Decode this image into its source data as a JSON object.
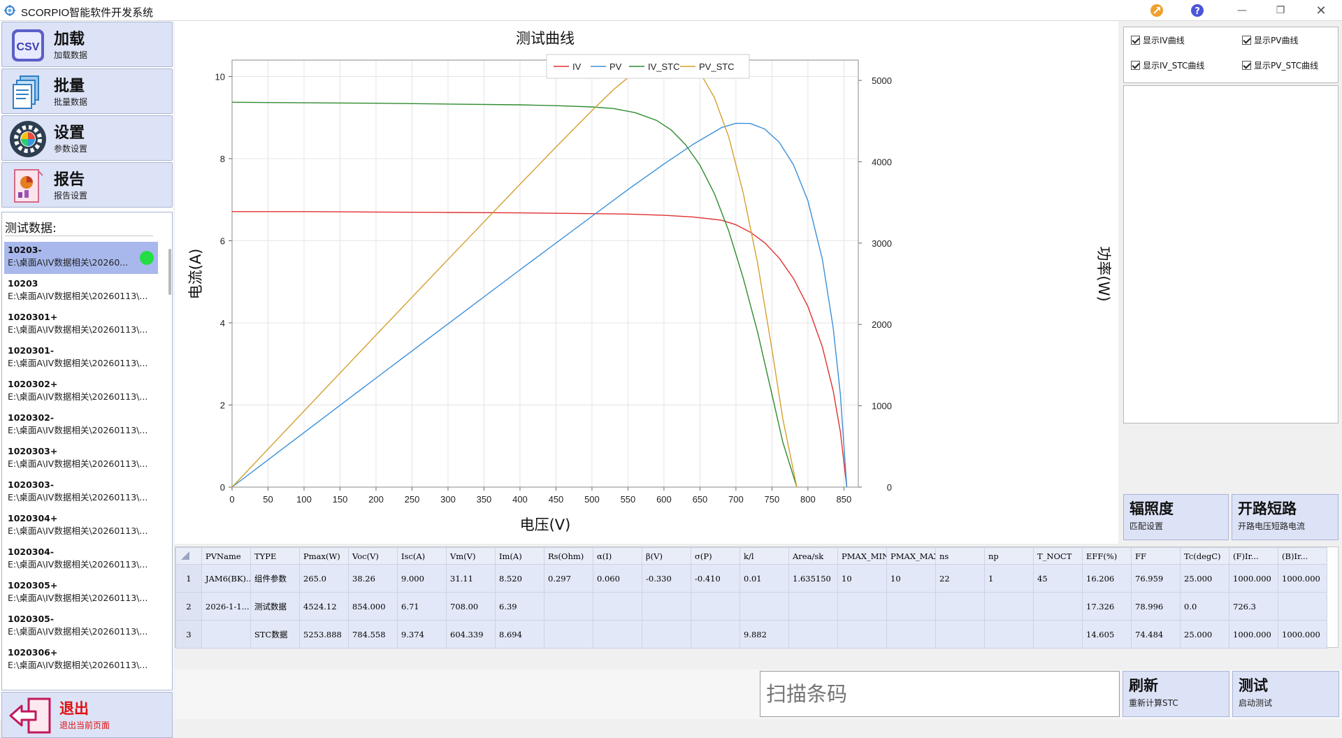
{
  "window": {
    "title": "SCORPIO智能软件开发系统"
  },
  "sidebar": {
    "nav": [
      {
        "label": "加载",
        "sub": "加载数据",
        "icon": "csv-file-icon"
      },
      {
        "label": "批量",
        "sub": "批量数据",
        "icon": "batch-files-icon"
      },
      {
        "label": "设置",
        "sub": "参数设置",
        "icon": "gear-icon"
      },
      {
        "label": "报告",
        "sub": "报告设置",
        "icon": "report-icon"
      }
    ],
    "list_title": "测试数据:",
    "items": [
      {
        "name": "10203-",
        "path": "E:\\桌面A\\IV数据相关\\20260..."
      },
      {
        "name": "10203",
        "path": "E:\\桌面A\\IV数据相关\\20260113\\..."
      },
      {
        "name": "1020301+",
        "path": "E:\\桌面A\\IV数据相关\\20260113\\..."
      },
      {
        "name": "1020301-",
        "path": "E:\\桌面A\\IV数据相关\\20260113\\..."
      },
      {
        "name": "1020302+",
        "path": "E:\\桌面A\\IV数据相关\\20260113\\..."
      },
      {
        "name": "1020302-",
        "path": "E:\\桌面A\\IV数据相关\\20260113\\..."
      },
      {
        "name": "1020303+",
        "path": "E:\\桌面A\\IV数据相关\\20260113\\..."
      },
      {
        "name": "1020303-",
        "path": "E:\\桌面A\\IV数据相关\\20260113\\..."
      },
      {
        "name": "1020304+",
        "path": "E:\\桌面A\\IV数据相关\\20260113\\..."
      },
      {
        "name": "1020304-",
        "path": "E:\\桌面A\\IV数据相关\\20260113\\..."
      },
      {
        "name": "1020305+",
        "path": "E:\\桌面A\\IV数据相关\\20260113\\..."
      },
      {
        "name": "1020305-",
        "path": "E:\\桌面A\\IV数据相关\\20260113\\..."
      },
      {
        "name": "1020306+",
        "path": "E:\\桌面A\\IV数据相关\\20260113\\..."
      }
    ],
    "exit": {
      "label": "退出",
      "sub": "退出当前页面"
    }
  },
  "right_panel": {
    "checkboxes": [
      "显示IV曲线",
      "显示PV曲线",
      "显示IV_STC曲线",
      "显示PV_STC曲线"
    ],
    "buttons": [
      {
        "label": "辐照度",
        "sub": "匹配设置"
      },
      {
        "label": "开路短路",
        "sub": "开路电压短路电流"
      }
    ]
  },
  "bottom": {
    "scan_placeholder": "扫描条码",
    "refresh": {
      "label": "刷新",
      "sub": "重新计算STC"
    },
    "test": {
      "label": "测试",
      "sub": "启动测试"
    }
  },
  "table": {
    "columns": [
      "PVName",
      "TYPE",
      "Pmax(W)",
      "Voc(V)",
      "Isc(A)",
      "Vm(V)",
      "Im(A)",
      "Rs(Ohm)",
      "α(I)",
      "β(V)",
      "σ(P)",
      "k/l",
      "Area/sk",
      "PMAX_MIN",
      "PMAX_MAX",
      "ns",
      "np",
      "T_NOCT",
      "EFF(%)",
      "FF",
      "Tc(degC)",
      "(F)Ir...",
      "(B)Ir..."
    ],
    "rows": [
      [
        "1",
        "JAM6(BK)...",
        "组件参数",
        "265.0",
        "38.26",
        "9.000",
        "31.11",
        "8.520",
        "0.297",
        "0.060",
        "-0.330",
        "-0.410",
        "0.01",
        "1.635150",
        "10",
        "10",
        "22",
        "1",
        "45",
        "16.206",
        "76.959",
        "25.000",
        "1000.000",
        "1000.000"
      ],
      [
        "2",
        "2026-1-1...",
        "测试数据",
        "4524.12",
        "854.000",
        "6.71",
        "708.00",
        "6.39",
        "",
        "",
        "",
        "",
        "",
        "",
        "",
        "",
        "",
        "",
        "",
        "17.326",
        "78.996",
        "0.0",
        "726.3",
        ""
      ],
      [
        "3",
        "",
        "STC数据",
        "5253.888",
        "784.558",
        "9.374",
        "604.339",
        "8.694",
        "",
        "",
        "",
        "",
        "9.882",
        "",
        "",
        "",
        "",
        "",
        "",
        "14.605",
        "74.484",
        "25.000",
        "1000.000",
        "1000.000"
      ]
    ]
  },
  "chart_data": {
    "type": "line",
    "title": "测试曲线",
    "xlabel": "电压(V)",
    "ylabel": "电流(A)",
    "y2label": "功率(W)",
    "xlim": [
      0,
      870
    ],
    "ylim": [
      0,
      10.4
    ],
    "y2lim": [
      0,
      5250
    ],
    "xticks": [
      0,
      50,
      100,
      150,
      200,
      250,
      300,
      350,
      400,
      450,
      500,
      550,
      600,
      650,
      700,
      750,
      800,
      850
    ],
    "yticks": [
      0,
      2,
      4,
      6,
      8,
      10
    ],
    "y2ticks": [
      0,
      1000,
      2000,
      3000,
      4000,
      5000
    ],
    "grid": true,
    "legend_position": "top-center",
    "series": [
      {
        "name": "IV",
        "axis": "left",
        "color": "#e03030",
        "x": [
          0,
          100,
          200,
          300,
          400,
          500,
          550,
          600,
          640,
          680,
          700,
          720,
          740,
          760,
          780,
          800,
          820,
          835,
          845,
          854
        ],
        "y": [
          6.71,
          6.71,
          6.7,
          6.69,
          6.68,
          6.66,
          6.65,
          6.62,
          6.58,
          6.5,
          6.39,
          6.21,
          5.95,
          5.58,
          5.08,
          4.4,
          3.42,
          2.35,
          1.35,
          0.0
        ]
      },
      {
        "name": "PV",
        "axis": "right",
        "color": "#3a8fd8",
        "x": [
          0,
          100,
          200,
          300,
          400,
          500,
          550,
          600,
          640,
          680,
          700,
          720,
          740,
          760,
          780,
          800,
          820,
          835,
          845,
          854
        ],
        "y": [
          0,
          671,
          1340,
          2007,
          2672,
          3330,
          3658,
          3972,
          4211,
          4420,
          4473,
          4471,
          4403,
          4241,
          3962,
          3520,
          2804,
          1962,
          1141,
          0
        ]
      },
      {
        "name": "IV_STC",
        "axis": "left",
        "color": "#2e8b2e",
        "x": [
          0,
          100,
          200,
          300,
          400,
          450,
          500,
          530,
          560,
          590,
          610,
          630,
          650,
          670,
          690,
          710,
          730,
          750,
          765,
          784.558
        ],
        "y": [
          9.374,
          9.36,
          9.35,
          9.33,
          9.31,
          9.29,
          9.26,
          9.22,
          9.12,
          8.93,
          8.7,
          8.34,
          7.84,
          7.15,
          6.24,
          5.1,
          3.78,
          2.26,
          1.1,
          0.0
        ]
      },
      {
        "name": "PV_STC",
        "axis": "right",
        "color": "#d4a030",
        "x": [
          0,
          100,
          200,
          300,
          400,
          450,
          500,
          530,
          560,
          590,
          610,
          630,
          650,
          670,
          690,
          710,
          730,
          750,
          765,
          784.558
        ],
        "y": [
          0,
          936,
          1870,
          2799,
          3724,
          4180,
          4630,
          4887,
          5107,
          5269,
          5307,
          5254,
          5096,
          4791,
          4306,
          3621,
          2759,
          1695,
          842,
          0
        ]
      }
    ]
  }
}
